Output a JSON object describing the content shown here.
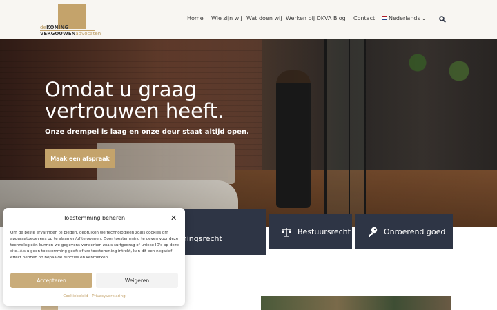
{
  "logo": {
    "line1_light": "de",
    "line1_bold": "KONING",
    "line2_bold": "VERGOUWEN",
    "line2_light": "advocaten"
  },
  "nav": {
    "items": [
      "Home",
      "Wie zijn wij",
      "Wat doen wij",
      "Werken bij DKVA",
      "Blog",
      "Contact"
    ],
    "language": "Nederlands"
  },
  "hero": {
    "title": "Omdat u graag vertrouwen heeft.",
    "subtitle": "Onze drempel is laag en onze deur staat altijd open.",
    "cta": "Maak een afspraak"
  },
  "cards": [
    {
      "label_line1": "n",
      "label_line2": "mingsrecht"
    },
    {
      "label": "Bestuursrecht",
      "icon": "scales-icon"
    },
    {
      "label": "Onroerend goed",
      "icon": "key-icon"
    }
  ],
  "consent": {
    "title": "Toestemming beheren",
    "text": "Om de beste ervaringen te bieden, gebruiken we technologieën zoals cookies om apparaatgegevens op te slaan en/of te openen. Door toestemming te geven voor deze technologieën kunnen we gegevens verwerken zoals surfgedrag of unieke ID's op deze site. Als u geen toestemming geeft of uw toestemming intrekt, kan dit een negatief effect hebben op bepaalde functies en kenmerken.",
    "accept": "Accepteren",
    "deny": "Weigeren",
    "link_cookie": "Cookiebeleid",
    "link_privacy": "Privacyverklaring"
  },
  "colors": {
    "gold": "#c4a36b",
    "navy": "#2e3545",
    "header_bg": "#f8f6f2"
  }
}
